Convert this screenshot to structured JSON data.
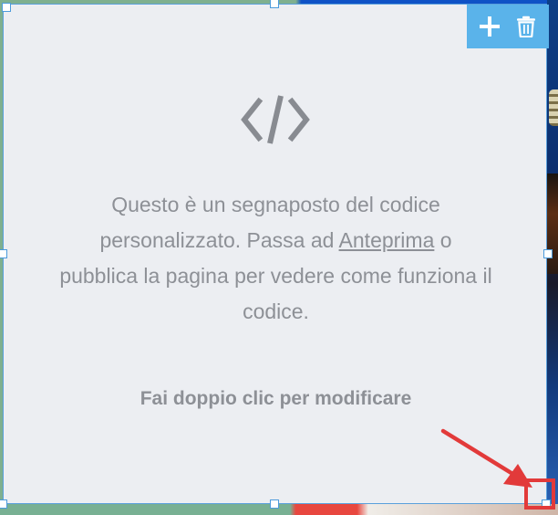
{
  "widget": {
    "icon": "code-brackets-icon",
    "message_before": "Questo è un segnaposto del codice personalizzato. Passa ad ",
    "preview_link": "Anteprima",
    "message_after": " o pubblica la pagina per vedere come funziona il codice.",
    "cta": "Fai doppio clic per modificare"
  },
  "toolbar": {
    "add_icon": "plus-icon",
    "delete_icon": "trash-icon"
  },
  "colors": {
    "toolbar_bg": "#5ab3ea",
    "widget_bg": "#eceef2",
    "selection_border": "#5aa0dc",
    "text": "#8d9096",
    "annotation": "#e23a3a"
  }
}
